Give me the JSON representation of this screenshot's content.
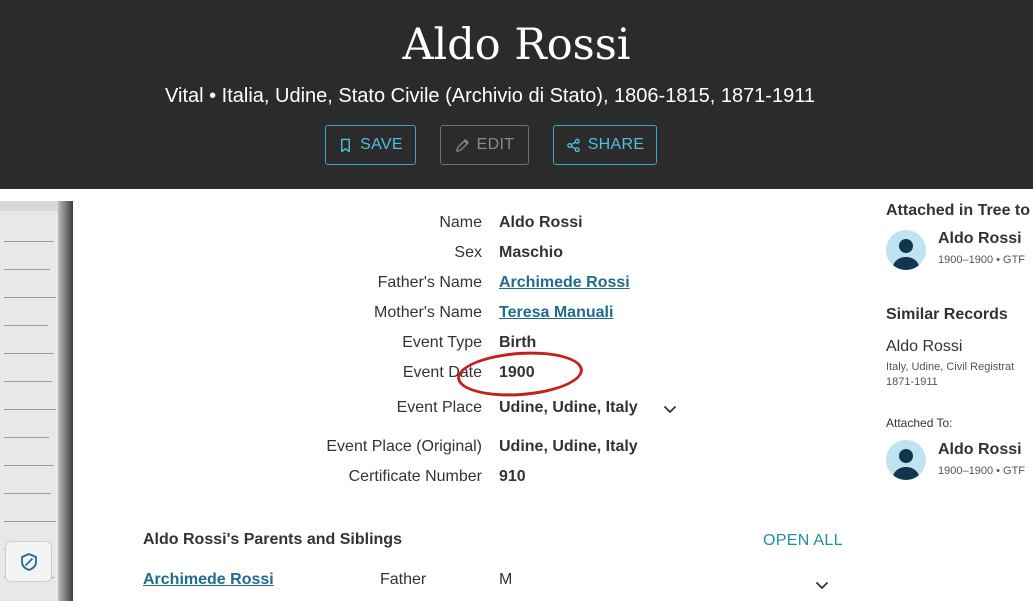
{
  "header": {
    "title": "Aldo Rossi",
    "subtitle": "Vital • Italia, Udine, Stato Civile (Archivio di Stato), 1806-1815, 1871-1911",
    "buttons": {
      "save": "SAVE",
      "edit": "EDIT",
      "share": "SHARE"
    }
  },
  "fields": [
    {
      "label": "Name",
      "value": "Aldo Rossi"
    },
    {
      "label": "Sex",
      "value": "Maschio"
    },
    {
      "label": "Father's Name",
      "value": "Archimede Rossi"
    },
    {
      "label": "Mother's Name",
      "value": "Teresa Manuali"
    },
    {
      "label": "Event Type",
      "value": "Birth"
    },
    {
      "label": "Event Date",
      "value": "1900"
    },
    {
      "label": "Event Place",
      "value": "Udine, Udine, Italy"
    },
    {
      "label": "Event Place (Original)",
      "value": "Udine, Udine, Italy"
    },
    {
      "label": "Certificate Number",
      "value": "910"
    }
  ],
  "family": {
    "title": "Aldo Rossi's Parents and Siblings",
    "open_all": "OPEN ALL",
    "rows": [
      {
        "name": "Archimede Rossi",
        "role": "Father",
        "sex": "M"
      }
    ]
  },
  "sidebar": {
    "attached_heading": "Attached in Tree to",
    "attached_person": {
      "name": "Aldo Rossi",
      "sub": "1900–1900 • GTF"
    },
    "similar_heading": "Similar Records",
    "similar": {
      "name": "Aldo Rossi",
      "sub1": "Italy, Udine, Civil Registrat",
      "sub2": "1871-1911"
    },
    "attached_to_label": "Attached To:",
    "attached_to_person": {
      "name": "Aldo Rossi",
      "sub": "1900–1900 • GTF"
    }
  },
  "colors": {
    "header_bg": "#2b2b2b",
    "accent": "#4fc0e0",
    "link": "#1e6d8c",
    "highlight": "#c61f1f"
  },
  "icons": {
    "save": "bookmark-icon",
    "edit": "pencil-icon",
    "share": "share-icon",
    "expand": "chevron-down-icon",
    "privacy": "shield-icon"
  }
}
